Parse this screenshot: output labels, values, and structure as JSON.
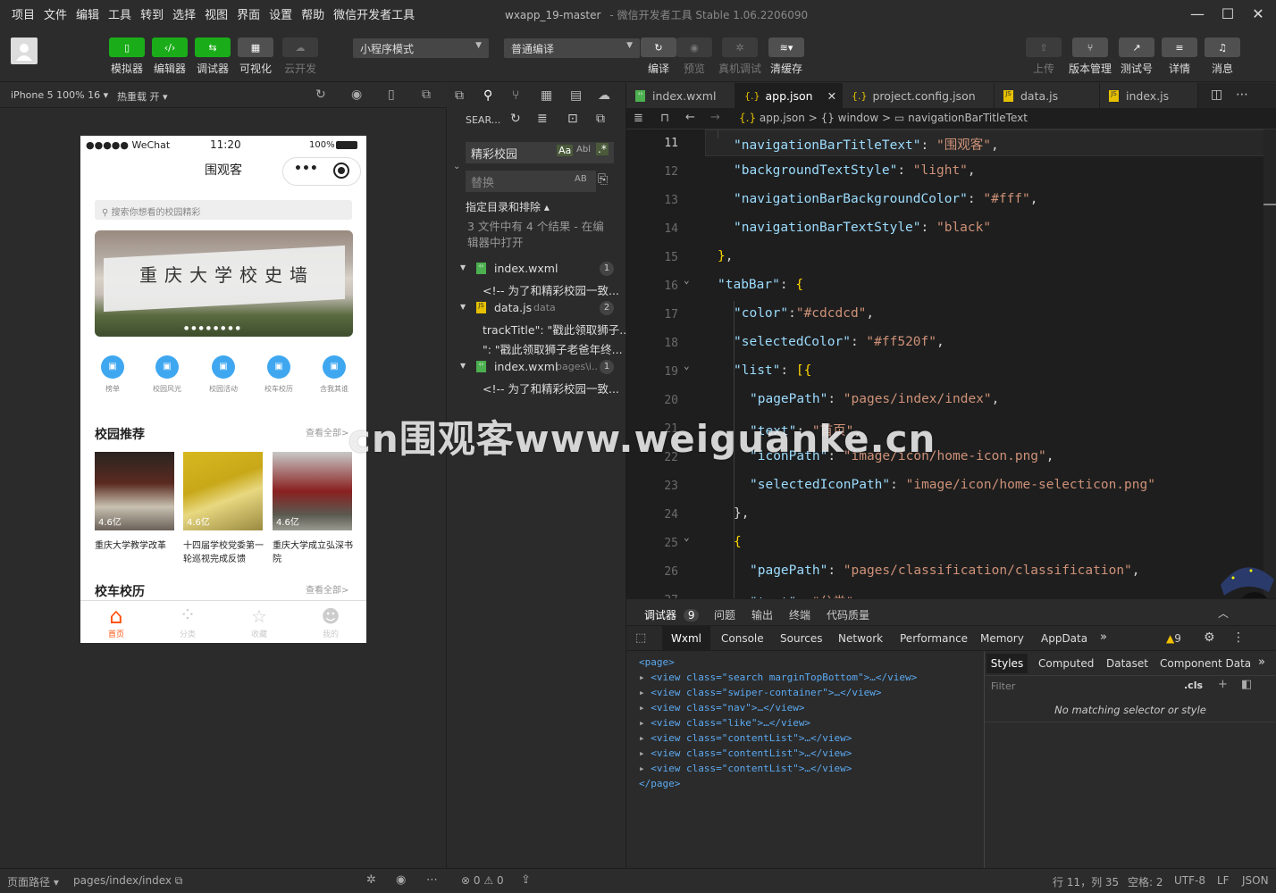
{
  "menu": [
    "项目",
    "文件",
    "编辑",
    "工具",
    "转到",
    "选择",
    "视图",
    "界面",
    "设置",
    "帮助",
    "微信开发者工具"
  ],
  "window": {
    "title": "wxapp_19-master",
    "subtitle": "- 微信开发者工具 Stable 1.06.2206090"
  },
  "toolbar": {
    "simulator": "模拟器",
    "editor": "编辑器",
    "debugger": "调试器",
    "visual": "可视化",
    "cloud": "云开发",
    "mode": "小程序模式",
    "compile_mode": "普通编译",
    "compile": "编译",
    "preview": "预览",
    "remote_debug": "真机调试",
    "clear_cache": "清缓存",
    "upload": "上传",
    "version": "版本管理",
    "test": "测试号",
    "detail": "详情",
    "message": "消息"
  },
  "simbar": {
    "device": "iPhone 5 100% 16",
    "hotreload": "热重载 开"
  },
  "phone": {
    "carrier": "●●●●● WeChat",
    "time": "11:20",
    "battery": "100%",
    "title": "围观客",
    "search_placeholder": "搜索你想看的校园精彩",
    "banner_text": "重庆大学校史墙",
    "nav": [
      "榜单",
      "校园风光",
      "校园活动",
      "校车校历",
      "含我其谁"
    ],
    "section1": "校园推荐",
    "more": "查看全部>",
    "cards": [
      {
        "views": "4.6亿",
        "title": "重庆大学教学改革"
      },
      {
        "views": "4.6亿",
        "title": "十四届学校党委第一轮巡视完成反馈"
      },
      {
        "views": "4.6亿",
        "title": "重庆大学成立弘深书院"
      }
    ],
    "section2": "校车校历",
    "tabbar": [
      "首页",
      "分类",
      "收藏",
      "我的"
    ]
  },
  "explorer": {
    "search_label": "SEAR...",
    "search_value": "精彩校园",
    "replace_placeholder": "替换",
    "scope": "指定目录和排除",
    "summary": "3 文件中有 4 个结果 - 在编辑器中打开",
    "results": [
      {
        "file": "index.wxml",
        "path": "",
        "count": "1",
        "lines": [
          "<!-- 为了和精彩校园一致..."
        ]
      },
      {
        "file": "data.js",
        "path": "data",
        "count": "2",
        "lines": [
          "trackTitle\": \"戳此领取狮子...",
          "\": \"戳此领取狮子老爸年终..."
        ]
      },
      {
        "file": "index.wxml",
        "path": "pages\\i...",
        "count": "1",
        "lines": [
          "<!-- 为了和精彩校园一致..."
        ]
      }
    ]
  },
  "tabs": [
    "index.wxml",
    "app.json",
    "project.config.json",
    "data.js",
    "index.js"
  ],
  "breadcrumb": [
    "app.json",
    ">",
    "{} window",
    ">",
    "navigationBarTitleText"
  ],
  "code": [
    {
      "n": "11",
      "t": [
        [
          "k",
          "\"navigationBarTitleText\""
        ],
        [
          "p",
          ": "
        ],
        [
          "s",
          "\"围观客\""
        ],
        [
          "p",
          ","
        ]
      ],
      "i": 1
    },
    {
      "n": "12",
      "t": [
        [
          "k",
          "\"backgroundTextStyle\""
        ],
        [
          "p",
          ": "
        ],
        [
          "s",
          "\"light\""
        ],
        [
          "p",
          ","
        ]
      ],
      "i": 1
    },
    {
      "n": "13",
      "t": [
        [
          "k",
          "\"navigationBarBackgroundColor\""
        ],
        [
          "p",
          ": "
        ],
        [
          "s",
          "\"#fff\""
        ],
        [
          "p",
          ","
        ]
      ],
      "i": 1
    },
    {
      "n": "14",
      "t": [
        [
          "k",
          "\"navigationBarTextStyle\""
        ],
        [
          "p",
          ": "
        ],
        [
          "s",
          "\"black\""
        ]
      ],
      "i": 1
    },
    {
      "n": "15",
      "t": [
        [
          "br",
          "}"
        ],
        [
          "p",
          ","
        ]
      ],
      "i": 0
    },
    {
      "n": "16",
      "t": [
        [
          "k",
          "\"tabBar\""
        ],
        [
          "p",
          ": "
        ],
        [
          "br",
          "{"
        ]
      ],
      "i": 0
    },
    {
      "n": "17",
      "t": [
        [
          "k",
          "\"color\""
        ],
        [
          "p",
          ":"
        ],
        [
          "s",
          "\"#cdcdcd\""
        ],
        [
          "p",
          ","
        ]
      ],
      "i": 1
    },
    {
      "n": "18",
      "t": [
        [
          "k",
          "\"selectedColor\""
        ],
        [
          "p",
          ": "
        ],
        [
          "s",
          "\"#ff520f\""
        ],
        [
          "p",
          ","
        ]
      ],
      "i": 1
    },
    {
      "n": "19",
      "t": [
        [
          "k",
          "\"list\""
        ],
        [
          "p",
          ": "
        ],
        [
          "br",
          "[{"
        ]
      ],
      "i": 1
    },
    {
      "n": "20",
      "t": [
        [
          "k",
          "\"pagePath\""
        ],
        [
          "p",
          ": "
        ],
        [
          "s",
          "\"pages/index/index\""
        ],
        [
          "p",
          ","
        ]
      ],
      "i": 2
    },
    {
      "n": "21",
      "t": [
        [
          "k",
          "\"text\""
        ],
        [
          "p",
          ": "
        ],
        [
          "s",
          "\"首页\""
        ],
        [
          "p",
          ","
        ]
      ],
      "i": 2
    },
    {
      "n": "22",
      "t": [
        [
          "k",
          "\"iconPath\""
        ],
        [
          "p",
          ": "
        ],
        [
          "s",
          "\"image/icon/home-icon.png\""
        ],
        [
          "p",
          ","
        ]
      ],
      "i": 2
    },
    {
      "n": "23",
      "t": [
        [
          "k",
          "\"selectedIconPath\""
        ],
        [
          "p",
          ": "
        ],
        [
          "s",
          "\"image/icon/home-selecticon.png\""
        ]
      ],
      "i": 2
    },
    {
      "n": "24",
      "t": [
        [
          "p",
          "},"
        ]
      ],
      "i": 1
    },
    {
      "n": "25",
      "t": [
        [
          "br",
          "{"
        ]
      ],
      "i": 1
    },
    {
      "n": "26",
      "t": [
        [
          "k",
          "\"pagePath\""
        ],
        [
          "p",
          ": "
        ],
        [
          "s",
          "\"pages/classification/classification\""
        ],
        [
          "p",
          ","
        ]
      ],
      "i": 2
    },
    {
      "n": "27",
      "t": [
        [
          "k",
          "\"text\""
        ],
        [
          "p",
          ": "
        ],
        [
          "s",
          "\"分类\""
        ],
        [
          "p",
          ","
        ]
      ],
      "i": 2
    }
  ],
  "debugger": {
    "tabs": [
      "调试器",
      "问题",
      "输出",
      "终端",
      "代码质量"
    ],
    "badge": "9",
    "devtabs": [
      "Wxml",
      "Console",
      "Sources",
      "Network",
      "Performance",
      "Memory",
      "AppData"
    ],
    "warn": "9",
    "tree": [
      [
        "<page>",
        ""
      ],
      [
        "<view class=\"search marginTopBottom\">…</view>",
        "1"
      ],
      [
        "<view class=\"swiper-container\">…</view>",
        "1"
      ],
      [
        "<view class=\"nav\">…</view>",
        "1"
      ],
      [
        "<view class=\"like\">…</view>",
        "1"
      ],
      [
        "<view class=\"contentList\">…</view>",
        "1"
      ],
      [
        "<view class=\"contentList\">…</view>",
        "1"
      ],
      [
        "<view class=\"contentList\">…</view>",
        "1"
      ],
      [
        "</page>",
        ""
      ]
    ],
    "style_tabs": [
      "Styles",
      "Computed",
      "Dataset",
      "Component Data"
    ],
    "filter": "Filter",
    "cls": ".cls",
    "nomatch": "No matching selector or style"
  },
  "status": {
    "path_label": "页面路径",
    "path": "pages/index/index",
    "errors": "0",
    "warnings": "0",
    "position": "行 11，列 35",
    "spaces": "空格: 2",
    "encoding": "UTF-8",
    "eol": "LF",
    "lang": "JSON"
  },
  "watermark": "cn围观客www.weiguanke.cn"
}
